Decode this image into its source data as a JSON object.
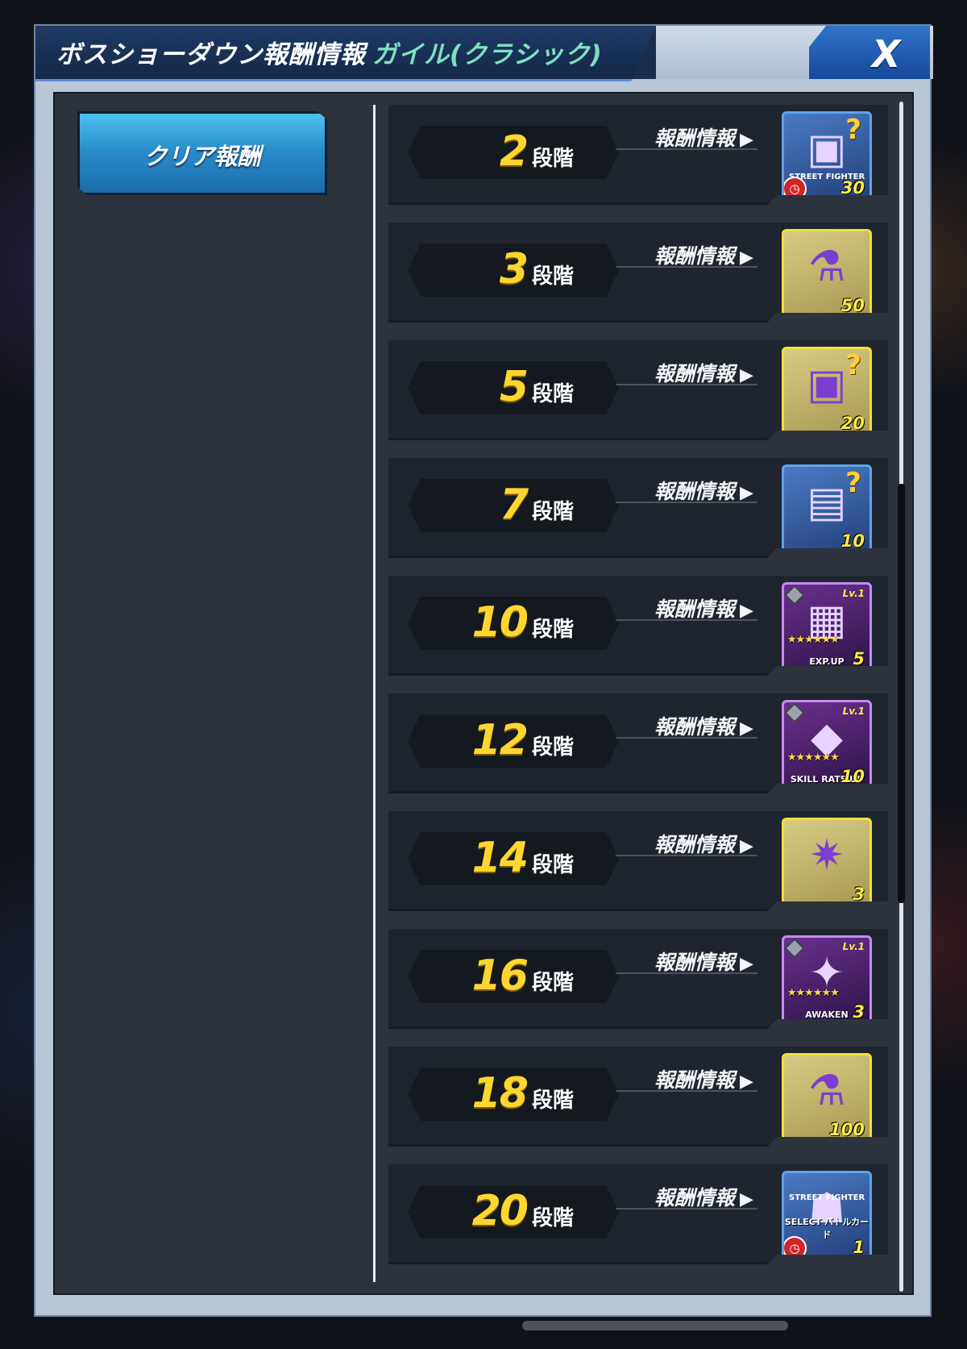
{
  "dialog": {
    "title": "ボスショーダウン報酬情報",
    "subtitle": "ガイル(クラシック)",
    "close_label": "X"
  },
  "sidebar": {
    "tabs": [
      {
        "label": "クリア報酬",
        "selected": true
      }
    ]
  },
  "rewards": {
    "stage_unit": "段階",
    "info_label": "報酬情報",
    "info_arrow": "▶",
    "rows": [
      {
        "stage": "2",
        "qty": "30",
        "icon": "mystery-box-icon",
        "frame": "blue",
        "brand": "STREET FIGHTER",
        "timed": true
      },
      {
        "stage": "3",
        "qty": "50",
        "icon": "potion-icon",
        "frame": "gold"
      },
      {
        "stage": "5",
        "qty": "20",
        "icon": "mystery-box-icon",
        "frame": "gold"
      },
      {
        "stage": "7",
        "qty": "10",
        "icon": "ticket-box-icon",
        "frame": "blue"
      },
      {
        "stage": "10",
        "qty": "5",
        "icon": "exp-card-icon",
        "frame": "purple",
        "tag": "EXP.UP",
        "level": "Lv.1"
      },
      {
        "stage": "12",
        "qty": "10",
        "icon": "skill-card-icon",
        "frame": "purple",
        "tag": "SKILL RATE UP",
        "level": "Lv.1"
      },
      {
        "stage": "14",
        "qty": "3",
        "icon": "star-emblem-icon",
        "frame": "gold"
      },
      {
        "stage": "16",
        "qty": "3",
        "icon": "awaken-card-icon",
        "frame": "purple",
        "tag": "AWAKEN",
        "level": "Lv.1"
      },
      {
        "stage": "18",
        "qty": "100",
        "icon": "potion-icon",
        "frame": "gold"
      },
      {
        "stage": "20",
        "qty": "1",
        "icon": "battle-card-icon",
        "frame": "blue",
        "brand": "STREET FIGHTER",
        "tag": "SELECT バトルカード",
        "timed": true
      }
    ]
  },
  "icon_glyphs": {
    "mystery-box-icon": "▣",
    "potion-icon": "⚗",
    "ticket-box-icon": "▤",
    "exp-card-icon": "▦",
    "skill-card-icon": "◆",
    "star-emblem-icon": "✷",
    "awaken-card-icon": "✦",
    "battle-card-icon": "☗"
  },
  "colors": {
    "accent_yellow": "#ffd630",
    "title_green": "#7ee0c0",
    "panel_bg": "#2c333d",
    "row_bg": "#1f252e",
    "tab_blue": "#2a8fcc"
  },
  "stars_text": "★★★★★★"
}
